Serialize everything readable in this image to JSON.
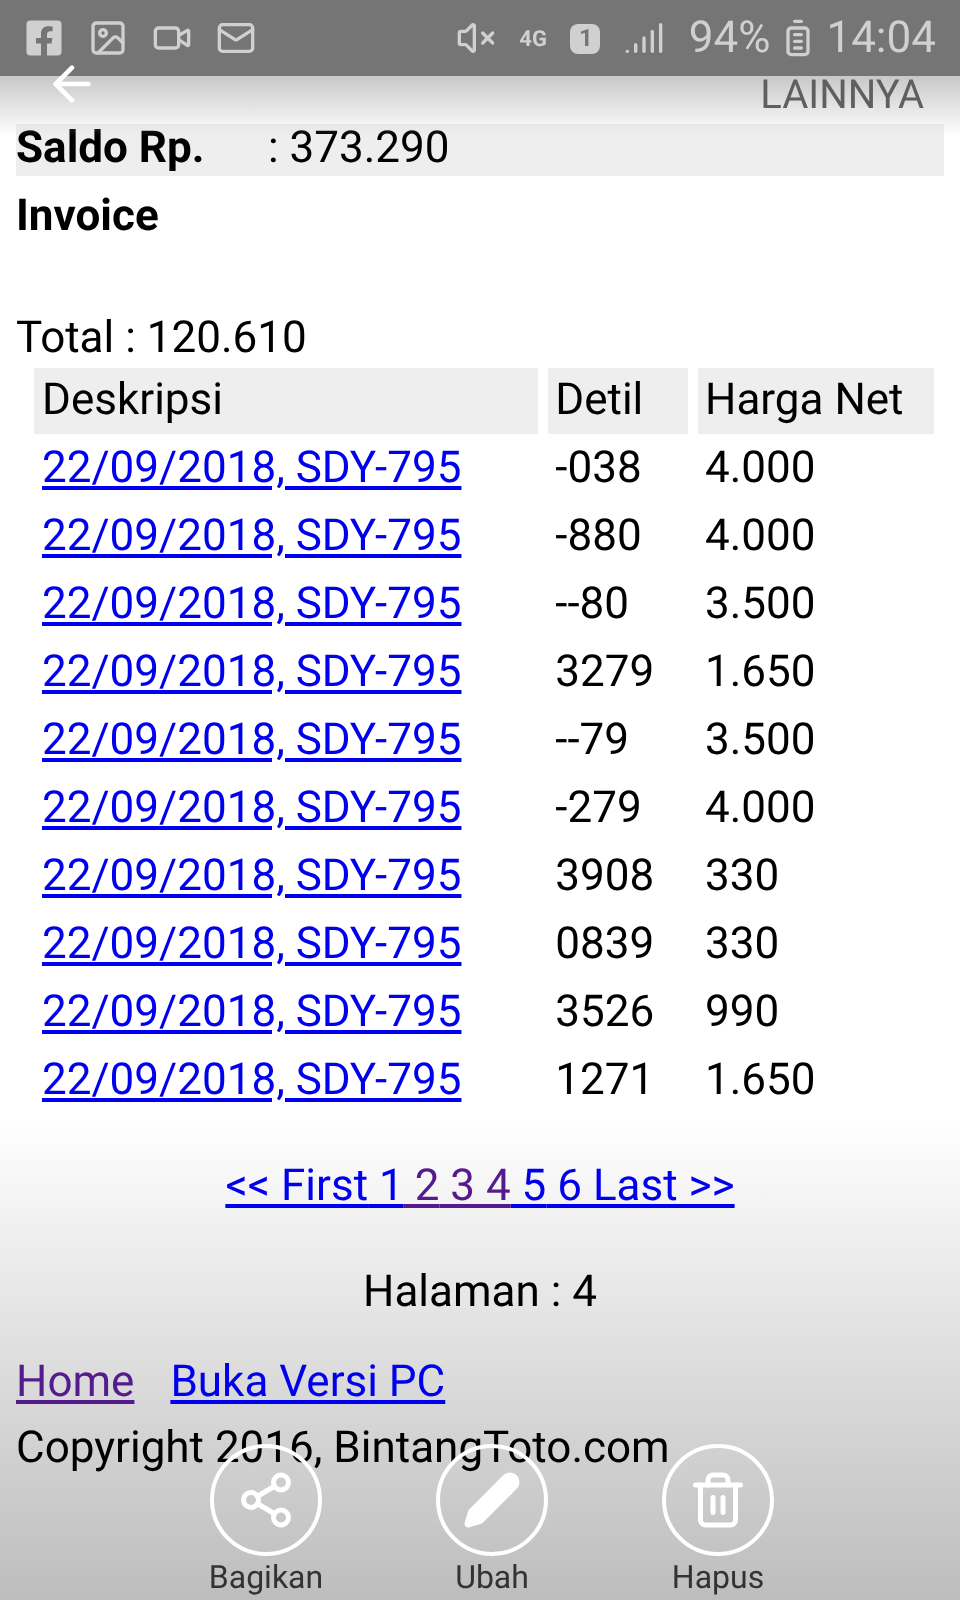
{
  "status_bar": {
    "network": "4G",
    "sim": "1",
    "battery": "94%",
    "time": "14:04"
  },
  "top_bar": {
    "menu": "LAINNYA"
  },
  "saldo": {
    "label": "Saldo Rp.",
    "value": ": 373.290"
  },
  "heading": "Invoice",
  "total": "Total : 120.610",
  "table": {
    "columns": [
      "Deskripsi",
      "Detil",
      "Harga Net"
    ],
    "rows": [
      {
        "link": "22/09/2018, SDY-795",
        "detail": "-038",
        "price": "4.000"
      },
      {
        "link": "22/09/2018, SDY-795",
        "detail": "-880",
        "price": "4.000"
      },
      {
        "link": "22/09/2018, SDY-795",
        "detail": "--80",
        "price": "3.500"
      },
      {
        "link": "22/09/2018, SDY-795",
        "detail": "3279",
        "price": "1.650"
      },
      {
        "link": "22/09/2018, SDY-795",
        "detail": "--79",
        "price": "3.500"
      },
      {
        "link": "22/09/2018, SDY-795",
        "detail": "-279",
        "price": "4.000"
      },
      {
        "link": "22/09/2018, SDY-795",
        "detail": "3908",
        "price": "330"
      },
      {
        "link": "22/09/2018, SDY-795",
        "detail": "0839",
        "price": "330"
      },
      {
        "link": "22/09/2018, SDY-795",
        "detail": "3526",
        "price": "990"
      },
      {
        "link": "22/09/2018, SDY-795",
        "detail": "1271",
        "price": "1.650"
      }
    ]
  },
  "pagination": [
    {
      "label": "<< First",
      "visited": false
    },
    {
      "label": "1",
      "visited": false
    },
    {
      "label": "2",
      "visited": true
    },
    {
      "label": "3",
      "visited": true
    },
    {
      "label": "4",
      "visited": true
    },
    {
      "label": "5",
      "visited": false
    },
    {
      "label": "6",
      "visited": false
    },
    {
      "label": "Last >>",
      "visited": false
    }
  ],
  "page_label": "Halaman : 4",
  "footer_links": [
    {
      "label": "Home",
      "visited": true
    },
    {
      "label": "Buka Versi PC",
      "visited": false
    }
  ],
  "copyright": "Copyright 2016, BintangToto.com",
  "actions": [
    {
      "kind": "share",
      "label": "Bagikan"
    },
    {
      "kind": "edit",
      "label": "Ubah"
    },
    {
      "kind": "delete",
      "label": "Hapus"
    }
  ]
}
